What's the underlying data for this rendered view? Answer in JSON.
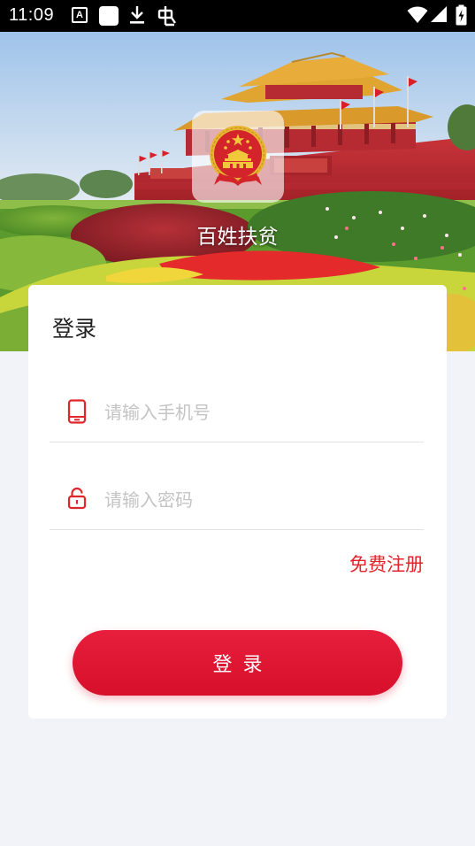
{
  "status_bar": {
    "time": "11:09",
    "notification_icons": [
      "text-a-icon",
      "square-app-icon",
      "download-icon",
      "bug-icon"
    ],
    "system_icons": [
      "wifi-icon",
      "cellular-signal-icon",
      "battery-charging-icon"
    ]
  },
  "header": {
    "app_name": "百姓扶贫",
    "logo_icon": "national-emblem-icon"
  },
  "login_form": {
    "title": "登录",
    "phone_placeholder": "请输入手机号",
    "phone_icon": "phone-icon",
    "password_placeholder": "请输入密码",
    "password_icon": "lock-icon",
    "register_label": "免费注册",
    "login_button_label": "登录"
  },
  "colors": {
    "accent": "#e0262b",
    "button": "#de1631",
    "page_background": "#f2f3f8",
    "card_background": "#ffffff",
    "status_bar": "#000000"
  }
}
